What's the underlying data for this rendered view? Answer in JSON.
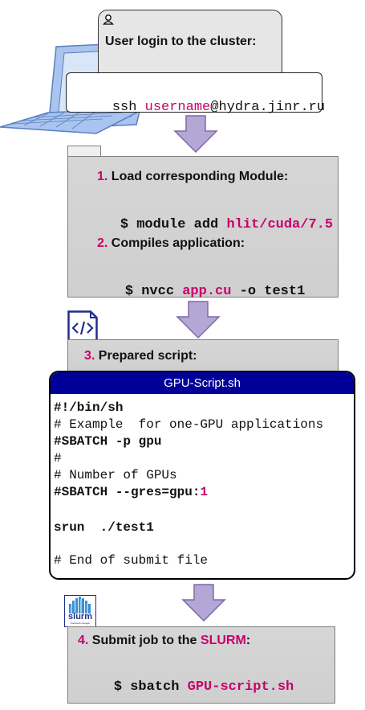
{
  "login": {
    "title": "User login to the cluster:",
    "cmd_prefix": "ssh ",
    "cmd_user": "username",
    "cmd_host": "@hydra.jinr.ru"
  },
  "step1": {
    "number": "1.",
    "title": "Load corresponding Module:",
    "cmd_prefix": "$ module add ",
    "cmd_module": "hlit/cuda/7.5"
  },
  "step2": {
    "number": "2.",
    "title": "Compiles application:",
    "cmd_prefix": "$ nvcc ",
    "cmd_file": "app.cu",
    "cmd_suffix": " -o test1"
  },
  "step3": {
    "number": "3.",
    "title": "Prepared script:"
  },
  "script": {
    "filename": "GPU-Script.sh",
    "line1": "#!/bin/sh",
    "line2": "# Example  for one-GPU applications",
    "line3": "#SBATCH -p gpu",
    "line4": "#",
    "line5": "# Number of GPUs",
    "line6_prefix": "#SBATCH --gres=gpu:",
    "line6_value": "1",
    "line7": "srun  ./test1",
    "line8": "# End of submit file"
  },
  "step4": {
    "number": "4.",
    "title_prefix": "Submit job to the ",
    "title_highlight": "SLURM",
    "title_suffix": ":",
    "cmd_prefix": "$ sbatch ",
    "cmd_file": "GPU-script.sh"
  },
  "icons": {
    "user": "user-icon",
    "laptop": "laptop-icon",
    "code": "code-file-icon",
    "slurm": "slurm-logo-icon"
  },
  "slurm_logo": {
    "text": "slurm",
    "subtext": "workload manager"
  },
  "colors": {
    "accent": "#c8006a",
    "arrow": "#b4a7d6",
    "script_header": "#000099",
    "laptop": "#a8c6f0"
  }
}
